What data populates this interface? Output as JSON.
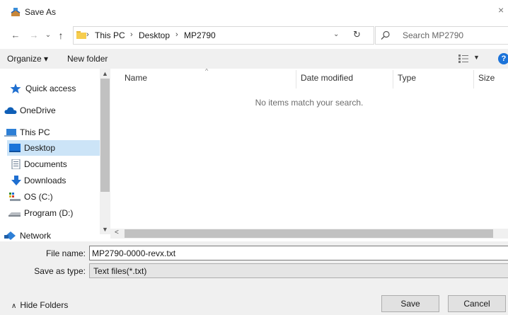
{
  "window": {
    "title": "Save As",
    "close_glyph": "×"
  },
  "nav_buttons": {
    "back": "←",
    "forward": "→",
    "recent": "⌄",
    "up": "↑"
  },
  "address": {
    "crumbs": [
      "This PC",
      "Desktop",
      "MP2790"
    ],
    "separator": "›",
    "dropdown_glyph": "⌄",
    "refresh_glyph": "↻"
  },
  "search": {
    "placeholder": "Search MP2790"
  },
  "toolbar": {
    "organize": "Organize ▾",
    "new_folder": "New folder",
    "view_dropdown": "▼",
    "help": "?"
  },
  "nav_pane": {
    "items": [
      {
        "label": "Quick access",
        "icon": "star-icon"
      },
      {
        "label": "OneDrive",
        "icon": "cloud-icon"
      },
      {
        "label": "This PC",
        "icon": "computer-icon"
      },
      {
        "label": "Desktop",
        "icon": "desktop-icon",
        "selected": true
      },
      {
        "label": "Documents",
        "icon": "documents-icon"
      },
      {
        "label": "Downloads",
        "icon": "download-icon"
      },
      {
        "label": "OS (C:)",
        "icon": "drive-icon"
      },
      {
        "label": "Program (D:)",
        "icon": "drive-icon"
      },
      {
        "label": "Network",
        "icon": "network-icon"
      }
    ]
  },
  "file_list": {
    "columns": [
      "Name",
      "Date modified",
      "Type",
      "Size"
    ],
    "empty_message": "No items match your search."
  },
  "form": {
    "file_name_label": "File name:",
    "file_name_value": "MP2790-0000-revx.txt",
    "save_as_type_label": "Save as type:",
    "save_as_type_value": "Text files(*.txt)"
  },
  "footer": {
    "hide_folders": "Hide Folders",
    "save": "Save",
    "cancel": "Cancel"
  },
  "colors": {
    "selection": "#cce4f7",
    "help_blue": "#1c73d9",
    "toolbar_bg": "#f0f0f0"
  }
}
